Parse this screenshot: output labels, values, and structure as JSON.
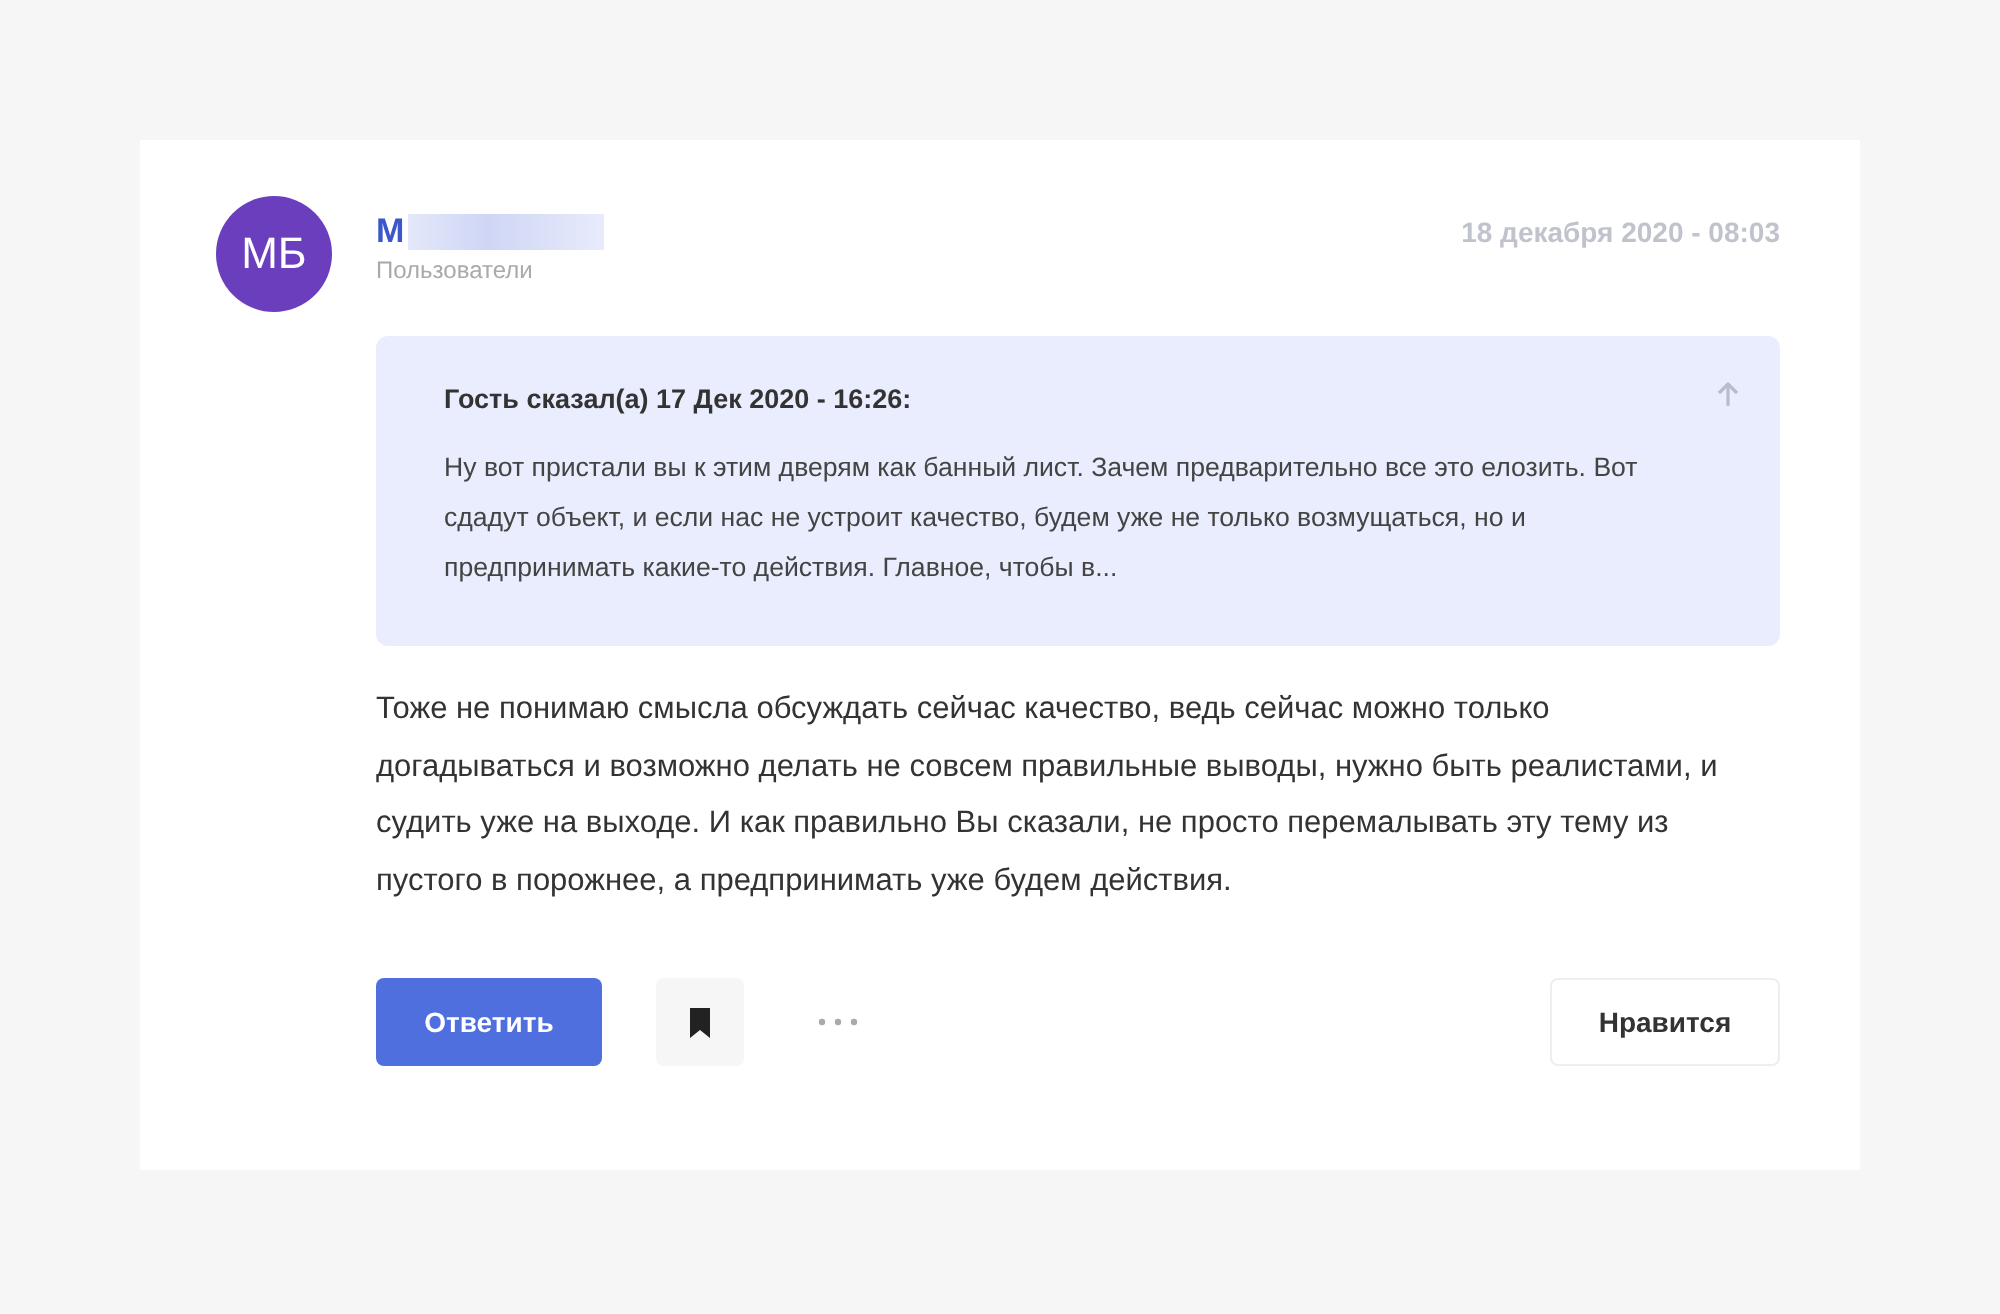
{
  "post": {
    "avatar_initials": "МБ",
    "author": "М",
    "group": "Пользователи",
    "date": "18 декабря 2020 - 08:03",
    "quote": {
      "header": "Гость сказал(а) 17 Дек 2020 - 16:26:",
      "text": "Ну вот пристали вы к этим дверям как банный лист. Зачем предварительно все это елозить. Вот сдадут объект, и если нас не устроит качество, будем уже не только возмущаться, но и предпринимать какие-то действия. Главное, чтобы в..."
    },
    "body": "Тоже не понимаю смысла обсуждать сейчас качество, ведь сейчас можно только догадываться и возможно делать не совсем правильные выводы, нужно быть реалистами, и судить уже на выходе. И как правильно Вы сказали, не просто перемалывать эту тему из пустого в порожнее, а предпринимать уже будем действия.",
    "reply_button": "Ответить",
    "like_button": "Нравится"
  }
}
